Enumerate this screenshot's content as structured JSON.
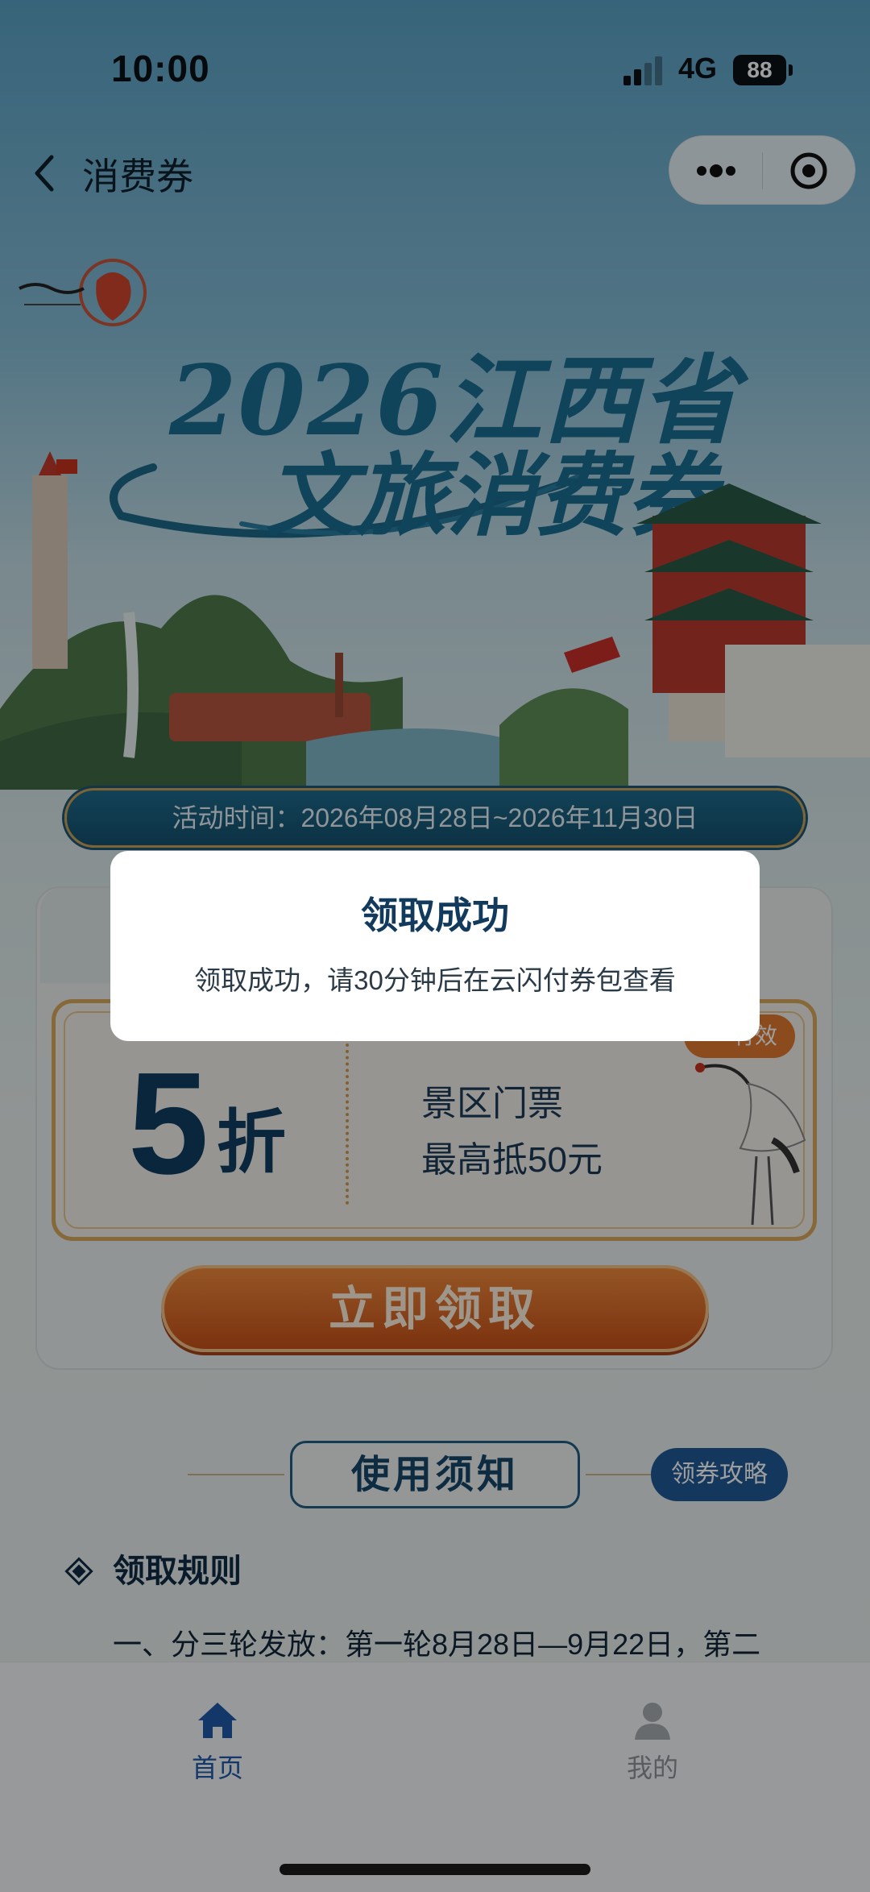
{
  "status_bar": {
    "time": "10:00",
    "network": "4G",
    "battery": "88"
  },
  "nav": {
    "title": "消费券",
    "back_icon": "chevron-left-icon",
    "more_icon": "more-dots-icon",
    "close_icon": "target-circle-icon"
  },
  "hero": {
    "year": "2026",
    "line1": "江西省",
    "line2": "文旅消费券"
  },
  "activity": {
    "time_label": "活动时间：2026年08月28日~2026年11月30日"
  },
  "coupon": {
    "discount_value": "5",
    "discount_unit": "折",
    "line1": "景区门票",
    "line2": "最高抵50元",
    "badge": "有效",
    "claim_button": "立即领取"
  },
  "notice": {
    "title": "使用须知",
    "guide_button": "领券攻略",
    "rules_heading": "领取规则",
    "rules_text": "一、分三轮发放：第一轮8月28日—9月22日，第二"
  },
  "tabbar": {
    "home_label": "首页",
    "mine_label": "我的"
  },
  "dialog": {
    "title": "领取成功",
    "message": "领取成功，请30分钟后在云闪付券包查看"
  },
  "colors": {
    "accent_blue": "#1f5aa8",
    "claim_orange": "#e07a2e",
    "title_navy": "#123a5c"
  }
}
